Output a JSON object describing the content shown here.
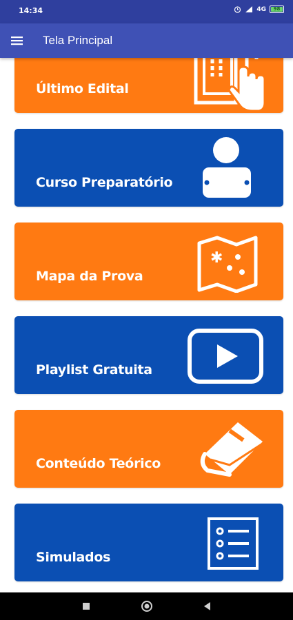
{
  "status_bar": {
    "time": "14:34",
    "network": "4G",
    "battery": "98"
  },
  "app_bar": {
    "title": "Tela Principal",
    "menu_icon": "hamburger-menu-icon"
  },
  "cards": [
    {
      "label": "Último Edital",
      "color": "#ff7a12",
      "icon": "document-tap-icon"
    },
    {
      "label": "Curso Preparatório",
      "color": "#0b4fb3",
      "icon": "student-laptop-icon"
    },
    {
      "label": "Mapa da Prova",
      "color": "#ff7a12",
      "icon": "map-icon"
    },
    {
      "label": "Playlist Gratuita",
      "color": "#0b4fb3",
      "icon": "play-video-icon"
    },
    {
      "label": "Conteúdo Teórico",
      "color": "#ff7a12",
      "icon": "book-icon"
    },
    {
      "label": "Simulados",
      "color": "#0b4fb3",
      "icon": "checklist-icon"
    }
  ],
  "nav_bar": {
    "icons": [
      "recents-square-icon",
      "home-circle-icon",
      "back-triangle-icon"
    ]
  },
  "colors": {
    "status_bar": "#2f3f9e",
    "app_bar": "#3f51b5",
    "orange": "#ff7a12",
    "blue": "#0b4fb3"
  }
}
